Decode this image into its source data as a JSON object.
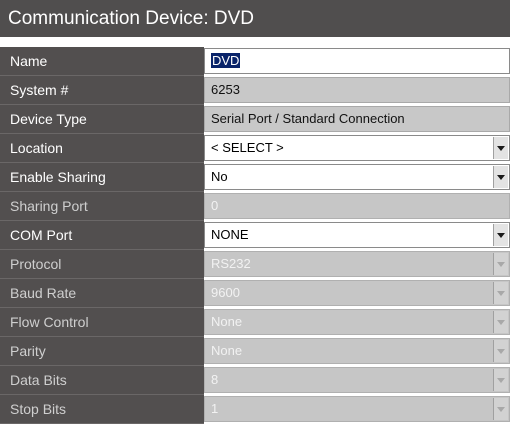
{
  "title": "Communication Device: DVD",
  "fields": [
    {
      "label": "Name",
      "value": "DVD",
      "state": "edit",
      "dropdown": false,
      "selected": true
    },
    {
      "label": "System #",
      "value": "6253",
      "state": "readonly",
      "dropdown": false
    },
    {
      "label": "Device Type",
      "value": "Serial Port / Standard Connection",
      "state": "readonly",
      "dropdown": false
    },
    {
      "label": "Location",
      "value": "< SELECT >",
      "state": "edit",
      "dropdown": true
    },
    {
      "label": "Enable Sharing",
      "value": "No",
      "state": "edit",
      "dropdown": true
    },
    {
      "label": "Sharing Port",
      "value": "0",
      "state": "disabled",
      "dropdown": false
    },
    {
      "label": "COM Port",
      "value": "NONE",
      "state": "edit",
      "dropdown": true
    },
    {
      "label": "Protocol",
      "value": "RS232",
      "state": "disabled",
      "dropdown": true
    },
    {
      "label": "Baud Rate",
      "value": "9600",
      "state": "disabled",
      "dropdown": true
    },
    {
      "label": "Flow Control",
      "value": "None",
      "state": "disabled",
      "dropdown": true
    },
    {
      "label": "Parity",
      "value": "None",
      "state": "disabled",
      "dropdown": true
    },
    {
      "label": "Data Bits",
      "value": "8",
      "state": "disabled",
      "dropdown": true
    },
    {
      "label": "Stop Bits",
      "value": "1",
      "state": "disabled",
      "dropdown": true
    }
  ],
  "colors": {
    "title_bg": "#504e4e",
    "label_bg": "#524f4f",
    "selection_bg": "#0a246a",
    "disabled_field_bg": "#c6c6c6"
  },
  "icons": {
    "dropdown": "chevron-down-icon"
  }
}
